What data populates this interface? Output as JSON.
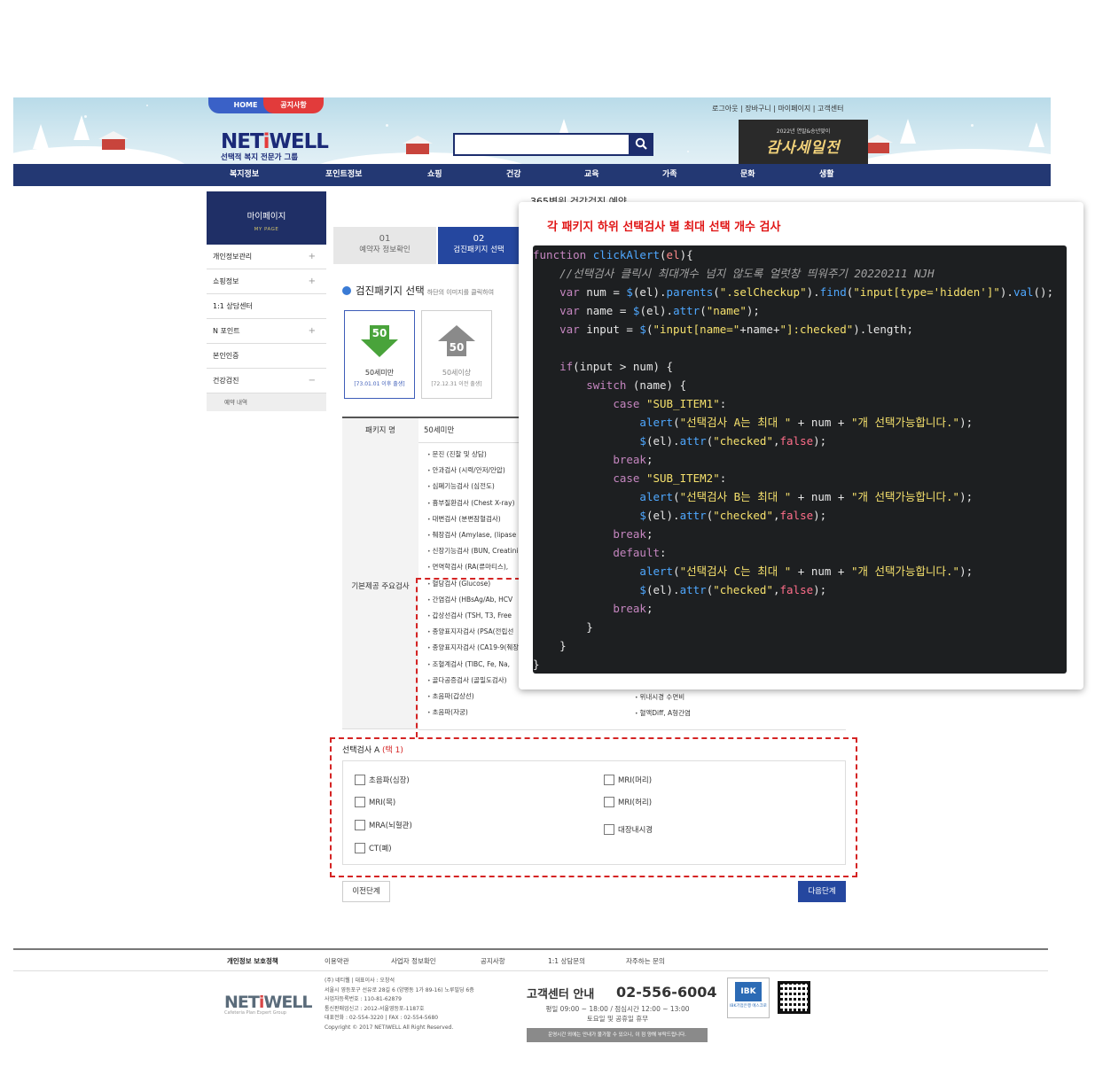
{
  "header": {
    "tab_home": "HOME",
    "tab_notice": "공지사항",
    "logo_brand_main": "NET",
    "logo_brand_i": "i",
    "logo_brand_end": "WELL",
    "logo_sub": "선택적 복지 전문가 그룹",
    "toplinks": "로그아웃 | 장바구니 | 마이페이지 | 고객센터",
    "banner_small": "2022년 연말&송년맞이",
    "banner_big": "감사세일전",
    "search_icon": "magnifier-icon"
  },
  "gnb": [
    "복지정보",
    "포인트정보",
    "쇼핑",
    "건강",
    "교육",
    "가족",
    "문화",
    "생활"
  ],
  "sidebar": {
    "title": "마이페이지",
    "subtitle": "MY PAGE",
    "items": [
      {
        "label": "개인정보관리",
        "mark": "+"
      },
      {
        "label": "쇼핑정보",
        "mark": "+"
      },
      {
        "label": "1:1 상담센터",
        "mark": ""
      },
      {
        "label": "N 포인트",
        "mark": "+"
      },
      {
        "label": "본인인증",
        "mark": ""
      },
      {
        "label": "건강검진",
        "mark": "−"
      }
    ],
    "sub_item": "예약 내역"
  },
  "main": {
    "page_title": "365병원 건강검진 예약",
    "steps": [
      {
        "num": "01",
        "label": "예약자 정보확인"
      },
      {
        "num": "02",
        "label": "검진패키지 선택"
      }
    ],
    "pkg_title": "검진패키지 선택",
    "pkg_hint": "하단의 이미지를 클릭하여",
    "cards": [
      {
        "badge": "50",
        "label": "50세미만",
        "range": "[73.01.01 이후 출생]"
      },
      {
        "badge": "50",
        "label": "50세이상",
        "range": "[72.12.31 이전 출생]"
      }
    ],
    "table": {
      "pkg_name_label": "패키지 명",
      "pkg_name_value": "50세미만",
      "basic_label": "기본제공 주요검사",
      "exams_left": [
        "문진 (진찰 및 상담)",
        "안과검사 (시력/안저/안압)",
        "심폐기능검사 (심전도)",
        "흉부질환검사 (Chest X-ray)",
        "대변검사 (분변잠혈검사)",
        "췌장검사 (Amylase, (lipase",
        "신장기능검사 (BUN, Creatinine",
        "면역학검사 (RA(류마티스),",
        "혈당검사 (Glucose)",
        "간염검사 (HBsAg/Ab, HCV",
        "갑상선검사 (TSH, T3, Free",
        "종양표지자검사 (PSA(전립선",
        "종양표지자검사 (CA19-9(췌장",
        "조혈계검사 (TIBC, Fe, Na,",
        "골다공증검사 (골밀도검사)",
        "초음파(갑상선)",
        "초음파(자궁)"
      ],
      "exams_right": [
        "위내시경 수면비",
        "혈액Diff, A형간염"
      ]
    },
    "options": {
      "title": "선택검사 A",
      "pick": "(택 1)",
      "items_left": [
        "초음파(심장)",
        "MRI(목)",
        "MRA(뇌혈관)",
        "CT(폐)"
      ],
      "items_right": [
        "MRI(머리)",
        "MRI(허리)",
        "대장내시경"
      ]
    },
    "btn_prev": "이전단계",
    "btn_next": "다음단계"
  },
  "popup": {
    "title": "각 패키지 하위 선택검사 별 최대 선택 개수 검사"
  },
  "footer": {
    "links": [
      "개인정보 보호정책",
      "이용약관",
      "사업자 정보확인",
      "공지사항",
      "1:1 상담문의",
      "자주하는 문의"
    ],
    "logo_main": "NET",
    "logo_i": "i",
    "logo_end": "WELL",
    "logo_sub": "Cafeteria Plan Expert Group",
    "info": [
      "(주) 네티웰 | 대표이사 : 오창석",
      "서울시 영등포구 선유로 28길 6 (양평동 1가 89-16) 노루빌딩 6층",
      "사업자등록번호 : 110-81-62879",
      "통신판매업신고 : 2012-서울영등포-1187호",
      "대표전화 : 02-554-3220 | FAX : 02-554-5680",
      "Copyright © 2017 NETIWELL All Right Reserved."
    ],
    "cs_title": "고객센터 안내",
    "cs_phone": "02-556-6004",
    "cs_hours1": "평일 09:00 ~ 18:00 / 점심시간 12:00 ~ 13:00",
    "cs_hours2": "토요일 및 공휴일 휴무",
    "cs_note": "운영시간 외에는 안내가 불가할 수 있으니, 이 점 양해 부탁드립니다.",
    "escrow_text": "IBK기업은행 에스크로"
  },
  "colors": {
    "navy": "#233873",
    "accent_blue": "#25479f",
    "red": "#d52424",
    "code_bg": "#1d1f21"
  }
}
